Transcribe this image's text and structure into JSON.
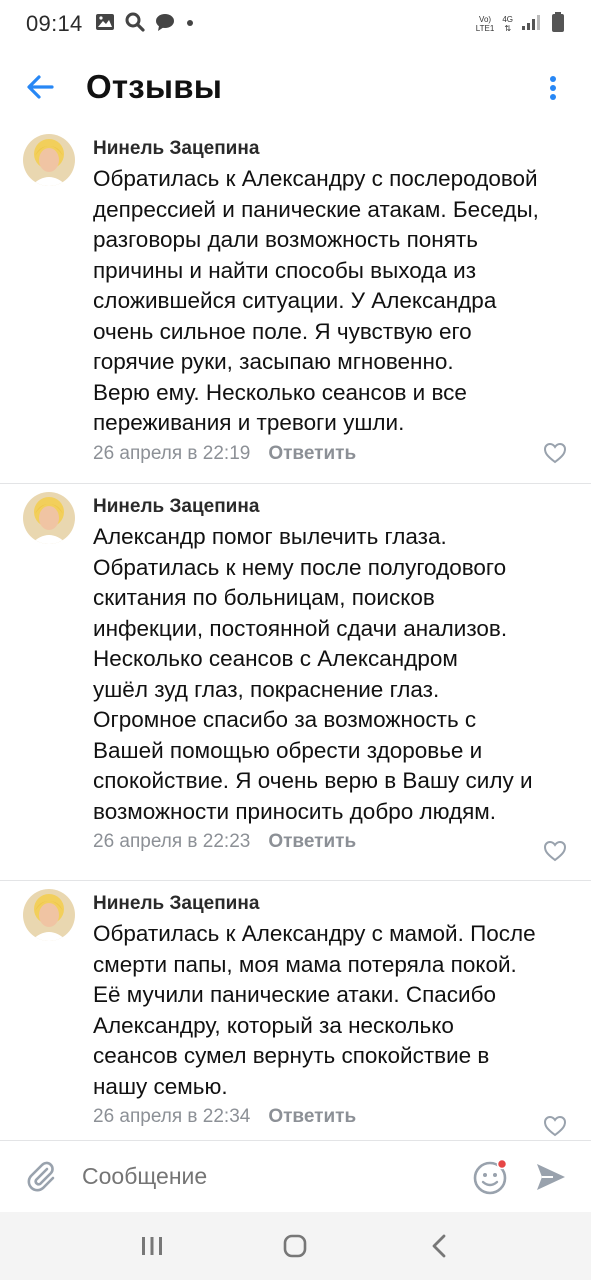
{
  "status_bar": {
    "time": "09:14",
    "network_line1": "Vo)",
    "network_line2": "LTE1",
    "network_type": "4G",
    "icons": [
      "gallery-icon",
      "search-icon",
      "chat-icon",
      "dot-icon",
      "signal-icon",
      "battery-icon"
    ]
  },
  "app_bar": {
    "title": "Отзывы",
    "back_icon": "arrow-left-icon",
    "menu_icon": "more-vertical-icon",
    "accent_color": "#2787f5"
  },
  "reviews": [
    {
      "author": "Нинель Зацепина",
      "text": "Обратилась к Александру с послеродовой\nдепрессией и панические атакам. Беседы,\nразговоры дали возможность понять\nпричины и найти способы выхода из\nсложившейся ситуации. У Александра\nочень сильное поле. Я чувствую его\nгорячие руки, засыпаю мгновенно.\nВерю ему. Несколько сеансов и все\nпереживания и тревоги ушли.",
      "date": "26 апреля в 22:19",
      "reply_label": "Ответить"
    },
    {
      "author": "Нинель Зацепина",
      "text": "Александр помог вылечить глаза.\nОбратилась к нему после полугодового\nскитания по больницам, поисков\nинфекции, постоянной сдачи анализов.\nНесколько сеансов с Александром\nушёл зуд глаз, покраснение глаз.\nОгромное спасибо за возможность с\nВашей помощью обрести здоровье и\nспокойствие. Я очень верю в Вашу силу и\nвозможности приносить добро людям.",
      "date": "26 апреля в 22:23",
      "reply_label": "Ответить"
    },
    {
      "author": "Нинель Зацепина",
      "text": "Обратилась к Александру с мамой. После\nсмерти папы, моя мама потеряла покой.\nЕё мучили панические атаки. Спасибо\nАлександру, который за несколько\nсеансов сумел вернуть спокойствие в\nнашу семью.",
      "date": "26 апреля в 22:34",
      "reply_label": "Ответить"
    }
  ],
  "composer": {
    "placeholder": "Сообщение",
    "attach_icon": "paperclip-icon",
    "emoji_icon": "smile-icon",
    "send_icon": "send-icon"
  },
  "nav_bar": {
    "buttons": [
      "recent-apps-icon",
      "home-icon",
      "back-icon"
    ]
  }
}
